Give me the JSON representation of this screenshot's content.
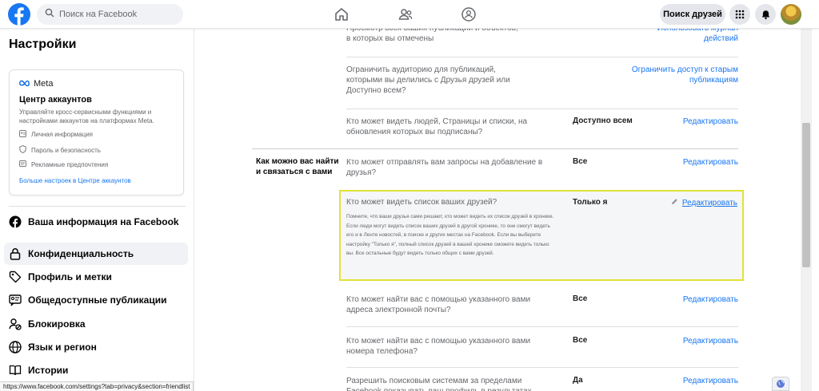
{
  "header": {
    "search_placeholder": "Поиск на Facebook",
    "find_friends_label": "Поиск друзей",
    "icons": [
      "facebook-logo-icon",
      "search-icon",
      "home-icon",
      "friends-icon",
      "groups-icon",
      "menu-grid-icon",
      "notifications-bell-icon"
    ]
  },
  "sidebar": {
    "title": "Настройки",
    "meta_card": {
      "brand": "Meta",
      "title": "Центр аккаунтов",
      "description": "Управляйте кросс-сервисными функциями и настройками аккаунтов на платформах Meta.",
      "items": [
        {
          "label": "Личная информация",
          "icon": "id-card-icon"
        },
        {
          "label": "Пароль и безопасность",
          "icon": "shield-icon"
        },
        {
          "label": "Рекламные предпочтения",
          "icon": "ad-icon"
        }
      ],
      "more_link": "Больше настроек в Центре аккаунтов"
    },
    "nav": [
      {
        "label": "Ваша информация на Facebook",
        "icon": "facebook-icon"
      },
      {
        "label": "Конфиденциальность",
        "icon": "lock-icon",
        "active": true
      },
      {
        "label": "Профиль и метки",
        "icon": "tag-icon"
      },
      {
        "label": "Общедоступные публикации",
        "icon": "public-posts-icon"
      },
      {
        "label": "Блокировка",
        "icon": "block-user-icon"
      },
      {
        "label": "Язык и регион",
        "icon": "globe-icon"
      },
      {
        "label": "Истории",
        "icon": "book-icon"
      }
    ]
  },
  "main": {
    "rows": [
      {
        "question": "Просмотр всех ваших публикаций и объектов, в которых вы отмечены",
        "value": "",
        "action": "Использовать журнал действий"
      },
      {
        "question": "Ограничить аудиторию для публикаций, которыми вы делились с Друзья друзей или Доступно всем?",
        "value": "",
        "action": "Ограничить доступ к старым публикациям"
      },
      {
        "question": "Кто может видеть людей, Страницы и списки, на обновления которых вы подписаны?",
        "value": "Доступно всем",
        "action": "Редактировать"
      }
    ],
    "section_title": "Как можно вас найти и связаться с вами",
    "section_rows": [
      {
        "question": "Кто может отправлять вам запросы на добавление в друзья?",
        "value": "Все",
        "action": "Редактировать"
      },
      {
        "question": "Кто может найти вас с помощью указанного вами адреса электронной почты?",
        "value": "Все",
        "action": "Редактировать"
      },
      {
        "question": "Кто может найти вас с помощью указанного вами номера телефона?",
        "value": "Все",
        "action": "Редактировать"
      },
      {
        "question": "Разрешить поисковым системам за пределами Facebook показывать ваш профиль в результатах поиска?",
        "value": "Да",
        "action": "Редактировать"
      }
    ],
    "highlighted": {
      "question": "Кто может видеть список ваших друзей?",
      "description": "Помните, что ваши друзья сами решают, кто может видеть их список друзей в хронике. Если люди могут видеть список ваших друзей в другой хронике, то они смогут видеть его и в Ленте новостей, в поиске и других местах на Facebook. Если вы выберете настройку \"Только я\", полный список друзей в вашей хронике сможете видеть только вы. Все остальные будут видеть только общих с вами друзей.",
      "value": "Только я",
      "action": "Редактировать"
    }
  },
  "status_url": "https://www.facebook.com/settings?tab=privacy&section=friendlist",
  "colors": {
    "brand": "#1877f2",
    "highlight_border": "#e0e236",
    "muted_text": "#65676b"
  }
}
